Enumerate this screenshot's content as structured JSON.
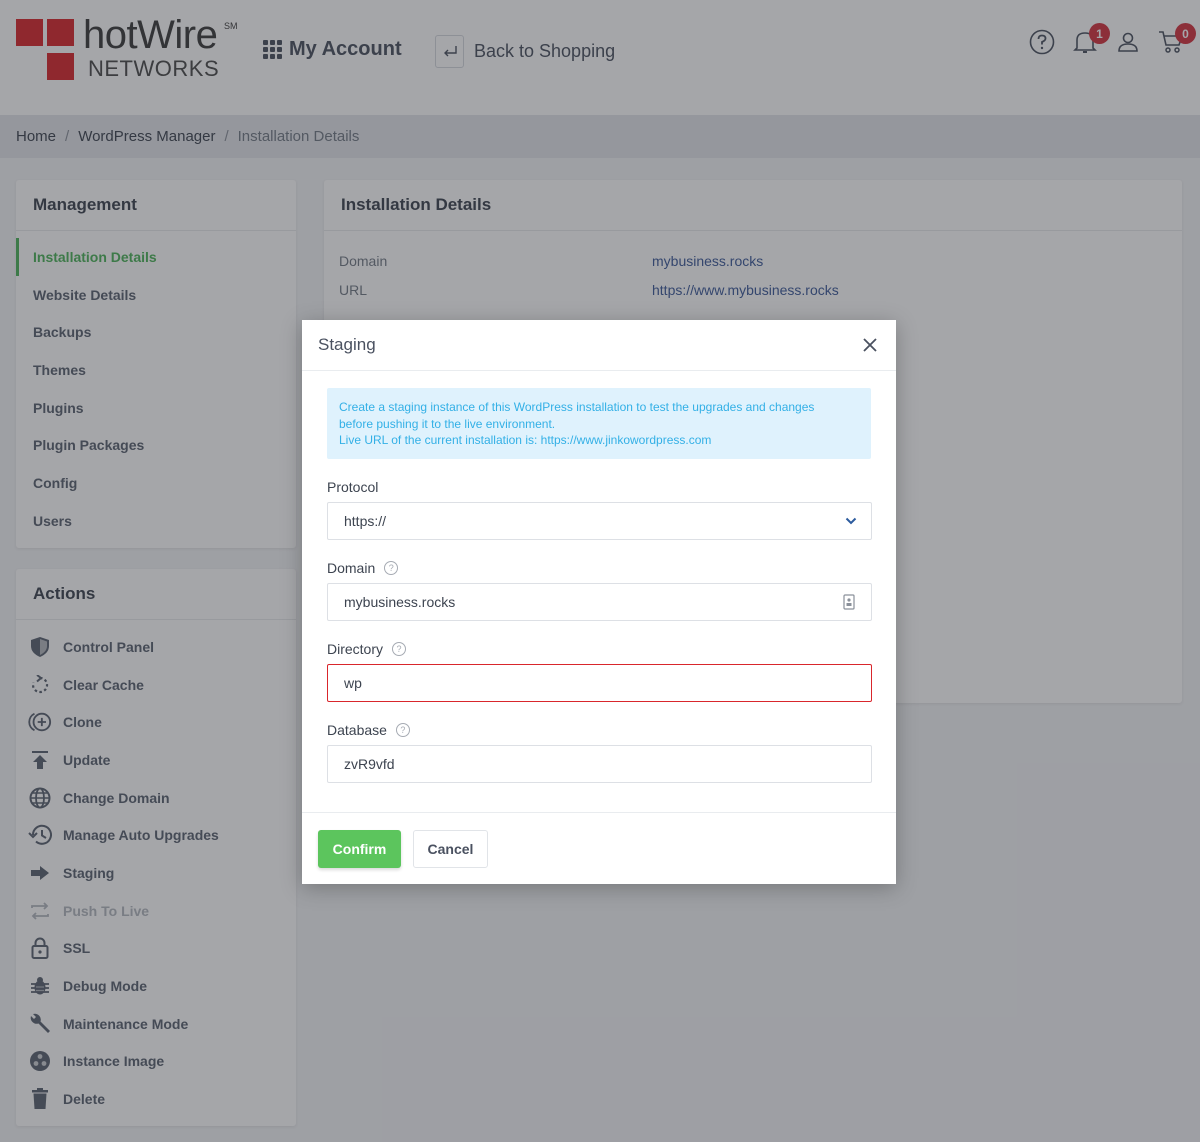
{
  "header": {
    "logo": {
      "brand": "hotWire",
      "trademark": "SM",
      "subtitle": "NETWORKS",
      "accent": "#d9262c"
    },
    "my_account_label": "My Account",
    "back_label": "Back to Shopping",
    "icons": [
      {
        "name": "help-icon"
      },
      {
        "name": "bell-icon",
        "badge": "1"
      },
      {
        "name": "user-icon"
      },
      {
        "name": "cart-icon",
        "badge": "0"
      }
    ]
  },
  "breadcrumb": {
    "items": [
      "Home",
      "WordPress Manager",
      "Installation Details"
    ],
    "separator": "/"
  },
  "management": {
    "title": "Management",
    "active_color": "#4db35a",
    "items": [
      {
        "label": "Installation Details",
        "active": true
      },
      {
        "label": "Website Details"
      },
      {
        "label": "Backups"
      },
      {
        "label": "Themes"
      },
      {
        "label": "Plugins"
      },
      {
        "label": "Plugin Packages"
      },
      {
        "label": "Config"
      },
      {
        "label": "Users"
      }
    ]
  },
  "actions": {
    "title": "Actions",
    "items": [
      {
        "label": "Control Panel",
        "icon": "shield-icon"
      },
      {
        "label": "Clear Cache",
        "icon": "refresh-icon"
      },
      {
        "label": "Clone",
        "icon": "clone-icon"
      },
      {
        "label": "Update",
        "icon": "upload-icon"
      },
      {
        "label": "Change Domain",
        "icon": "globe-icon"
      },
      {
        "label": "Manage Auto Upgrades",
        "icon": "history-icon"
      },
      {
        "label": "Staging",
        "icon": "arrow-right-icon"
      },
      {
        "label": "Push To Live",
        "icon": "swap-icon",
        "disabled": true
      },
      {
        "label": "SSL",
        "icon": "lock-icon"
      },
      {
        "label": "Debug Mode",
        "icon": "bug-icon"
      },
      {
        "label": "Maintenance Mode",
        "icon": "wrench-icon"
      },
      {
        "label": "Instance Image",
        "icon": "image-icon"
      },
      {
        "label": "Delete",
        "icon": "trash-icon"
      }
    ]
  },
  "details": {
    "title": "Installation Details",
    "rows": [
      {
        "key": "Domain",
        "value": "mybusiness.rocks"
      },
      {
        "key": "URL",
        "value": "https://www.mybusiness.rocks"
      }
    ]
  },
  "modal": {
    "title": "Staging",
    "info_lines": [
      "Create a staging instance of this WordPress installation to test the upgrades and changes",
      "before pushing it to the live environment.",
      "Live URL of the current installation is: https://www.jinkowordpress.com"
    ],
    "fields": {
      "protocol": {
        "label": "Protocol",
        "value": "https://"
      },
      "domain": {
        "label": "Domain",
        "value": "mybusiness.rocks"
      },
      "directory": {
        "label": "Directory",
        "value": "wp",
        "error": true
      },
      "database": {
        "label": "Database",
        "value": "zvR9vfd"
      }
    },
    "confirm_label": "Confirm",
    "cancel_label": "Cancel",
    "confirm_color": "#5cc55d",
    "error_color": "#d9262c"
  }
}
